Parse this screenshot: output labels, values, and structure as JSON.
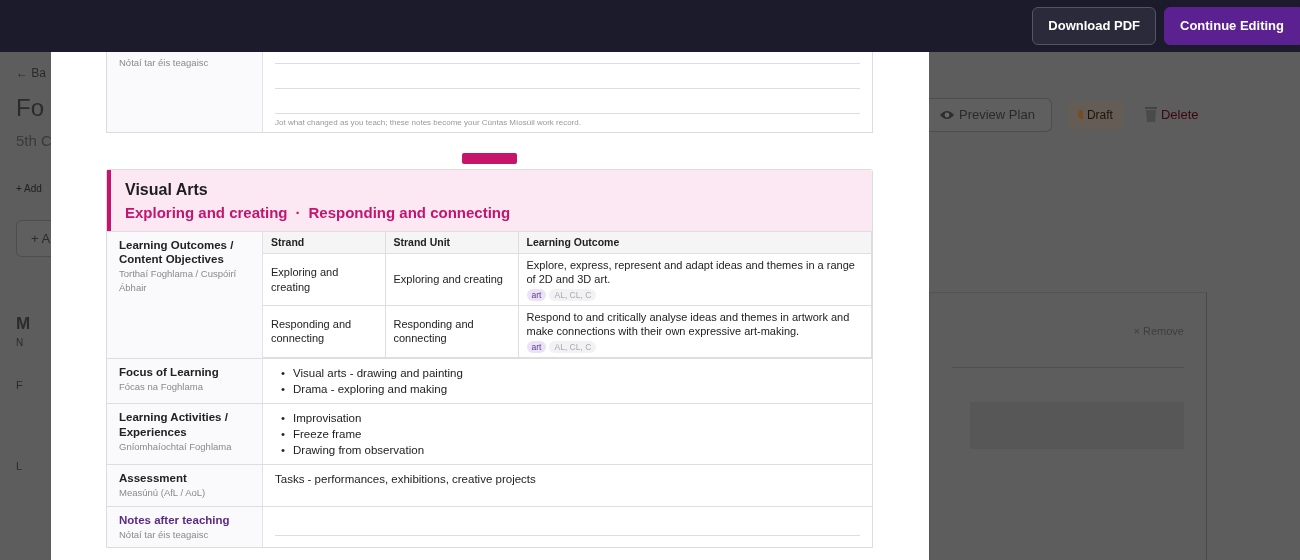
{
  "header": {
    "buttons": [
      {
        "label": "Download PDF",
        "kind": "secondary"
      },
      {
        "label": "Continue Editing",
        "kind": "primary"
      }
    ]
  },
  "background_page": {
    "back_link": "← Ba",
    "title": "Fo",
    "subtitle": "5th C",
    "add_link": "+ Add",
    "add_button": "+ A",
    "fragments": [
      "M",
      "N",
      "F",
      "L"
    ],
    "actions": [
      {
        "label": "Preview Plan",
        "kind": "preview"
      },
      {
        "label": "Draft",
        "kind": "draft"
      },
      {
        "label": "Delete",
        "kind": "delete"
      }
    ],
    "card": {
      "remove": "× Remove"
    }
  },
  "preview": {
    "previous_notes": {
      "label_irish": "Nótaí tar éis teagaisc",
      "hint": "Jot what changed as you teach; these notes become your Cúntas Míosúil work record."
    },
    "subject": {
      "title": "Visual Arts",
      "strands": [
        "Exploring and creating",
        "Responding and connecting"
      ],
      "separator": "·",
      "rows": [
        {
          "kind": "outcomes",
          "label": "Learning Outcomes / Content Objectives",
          "label_irish": "Torthaí Foghlama / Cuspóirí Ábhair",
          "columns": [
            "Strand",
            "Strand Unit",
            "Learning Outcome"
          ],
          "items": [
            {
              "strand": "Exploring and creating",
              "unit": "Exploring and creating",
              "outcome": "Explore, express, represent and adapt ideas and themes in a range of 2D and 3D art.",
              "tags": [
                {
                  "label": "art",
                  "kind": "subject"
                },
                {
                  "label": "AL, CL, C",
                  "kind": "codes"
                }
              ]
            },
            {
              "strand": "Responding and connecting",
              "unit": "Responding and connecting",
              "outcome": "Respond to and critically analyse ideas and themes in artwork and make connections with their own expressive art-making.",
              "tags": [
                {
                  "label": "art",
                  "kind": "subject"
                },
                {
                  "label": "AL, CL, C",
                  "kind": "codes"
                }
              ]
            }
          ]
        },
        {
          "kind": "list",
          "bullet": "•",
          "label": "Focus of Learning",
          "label_irish": "Fócas na Foghlama",
          "items": [
            "Visual arts - drawing and painting",
            "Drama - exploring and making"
          ]
        },
        {
          "kind": "list",
          "bullet": "•",
          "label": "Learning Activities / Experiences",
          "label_irish": "Gníomhaíochtaí Foghlama",
          "items": [
            "Improvisation",
            "Freeze frame",
            "Drawing from observation"
          ]
        },
        {
          "kind": "text",
          "label": "Assessment",
          "label_irish": "Measúnú (AfL / AoL)",
          "text": "Tasks - performances, exhibitions, creative projects"
        },
        {
          "kind": "notes",
          "label": "Notes after teaching",
          "label_irish": "Nótaí tar éis teagaisc"
        }
      ]
    }
  }
}
